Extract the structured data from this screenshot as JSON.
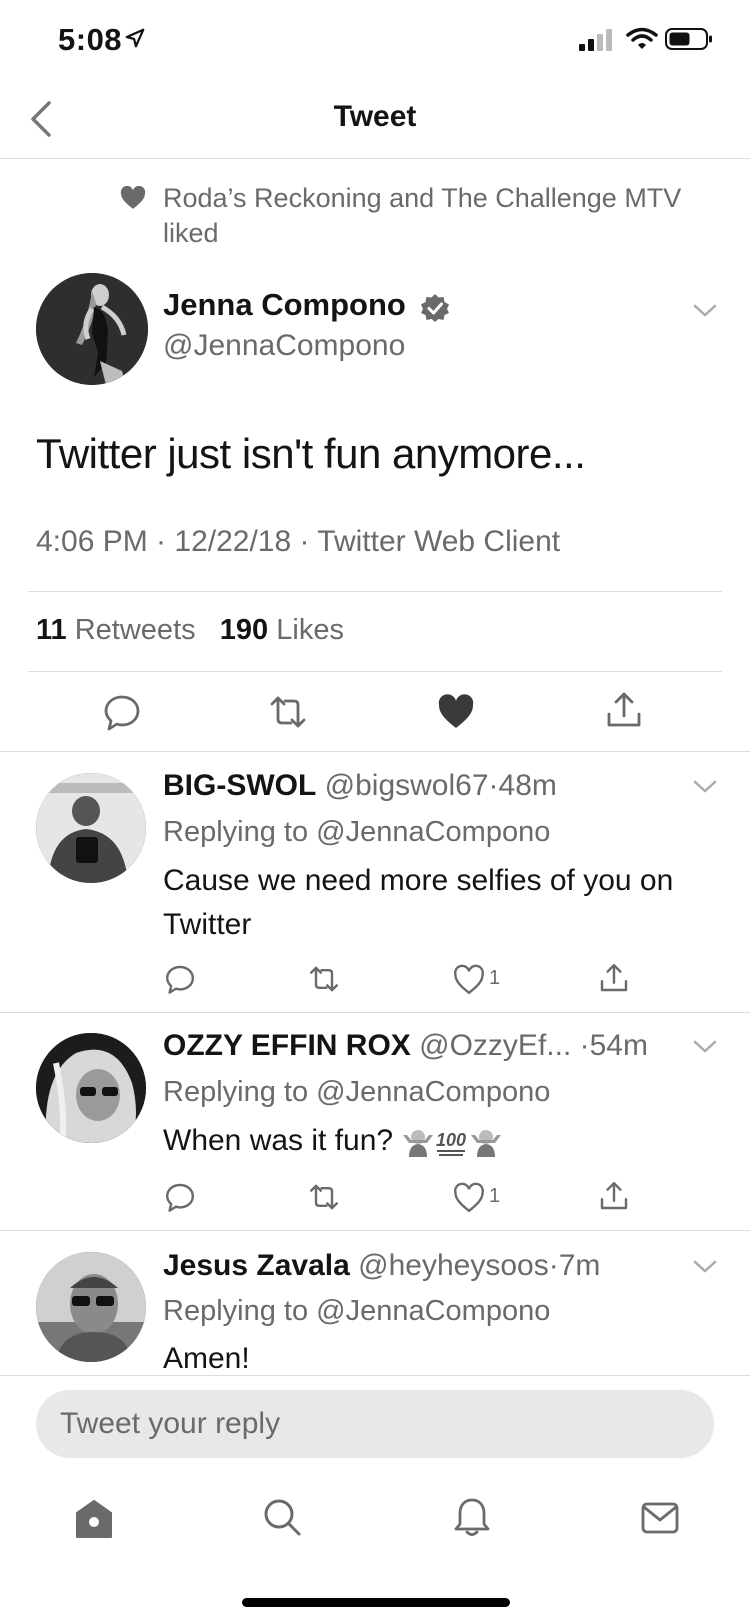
{
  "status_bar": {
    "time": "5:08"
  },
  "nav": {
    "title": "Tweet"
  },
  "tweet": {
    "social_context": "Roda’s Reckoning and The Challenge MTV liked",
    "author_name": "Jenna Compono",
    "author_handle": "@JennaCompono",
    "text": "Twitter just isn't fun anymore...",
    "meta": "4:06 PM · 12/22/18 · Twitter Web Client",
    "retweets_count": "11",
    "retweets_label": "Retweets",
    "likes_count": "190",
    "likes_label": "Likes"
  },
  "replies": [
    {
      "name": "BIG-SWOL",
      "handle": "@bigswol67",
      "time": "·48m",
      "replying_to": "Replying to @JennaCompono",
      "text": "Cause we need more selfies of you on Twitter",
      "likes": "1"
    },
    {
      "name": "OZZY EFFIN ROX",
      "handle": "@OzzyEf...",
      "time": "·54m",
      "replying_to": "Replying to @JennaCompono",
      "text": "When was it fun?",
      "likes": "1"
    },
    {
      "name": "Jesus Zavala",
      "handle": "@heyheysoos",
      "time": "·7m",
      "replying_to": "Replying to @JennaCompono",
      "text": "Amen!"
    }
  ],
  "reply_box": {
    "placeholder": "Tweet your reply"
  },
  "icons": {
    "back": "chevron-left-icon",
    "verified": "verified-badge-icon",
    "reply": "reply-icon",
    "retweet": "retweet-icon",
    "like": "heart-icon",
    "share": "share-icon",
    "tabs": [
      "home-icon",
      "search-icon",
      "notifications-icon",
      "messages-icon"
    ],
    "emoji": [
      "person-shrugging-emoji",
      "hundred-points-emoji",
      "person-shrugging-emoji"
    ]
  }
}
